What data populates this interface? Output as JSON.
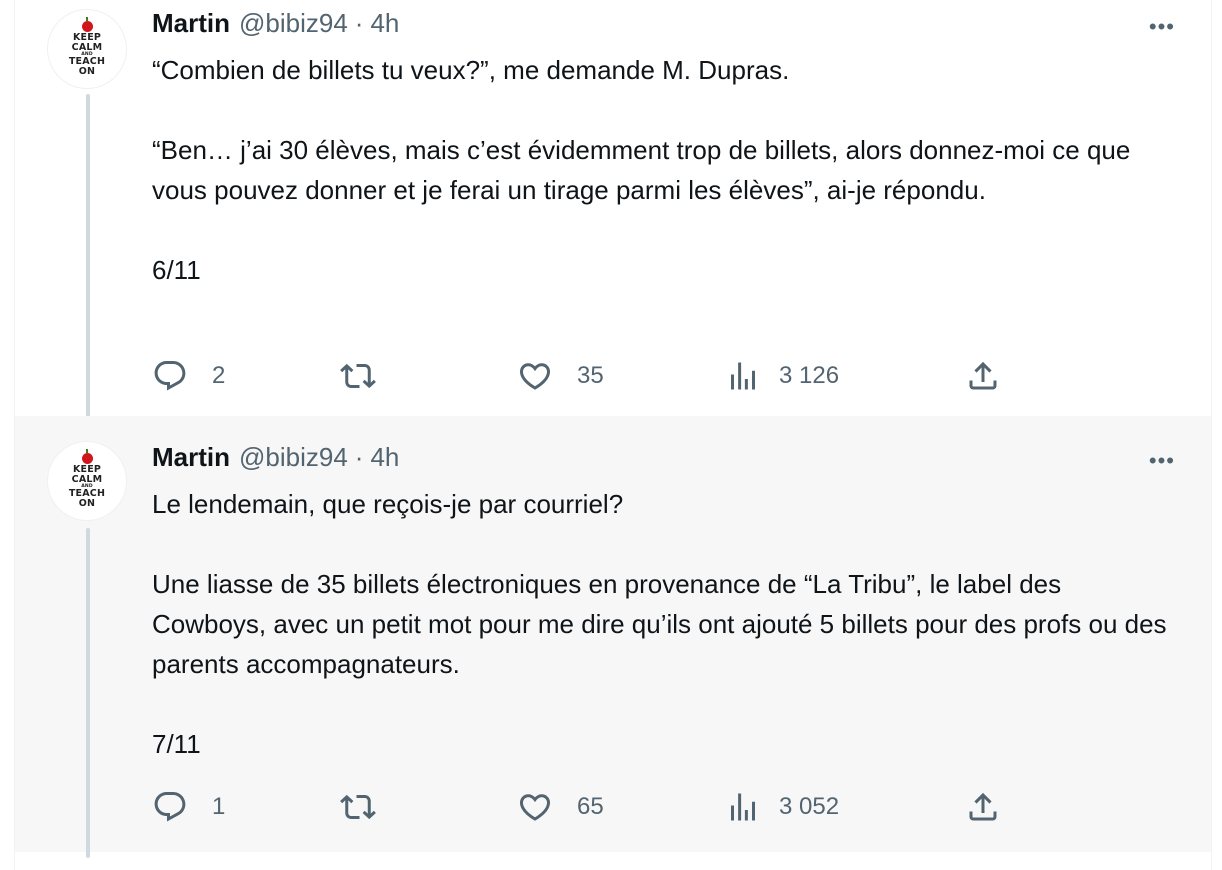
{
  "tweets": [
    {
      "author": {
        "name": "Martin",
        "handle": "@bibiz94",
        "separator": "·",
        "time": "4h"
      },
      "avatar": {
        "line1": "KEEP",
        "line2": "CALM",
        "line3": "AND",
        "line4": "TEACH",
        "line5": "ON"
      },
      "paragraphs": [
        "“Combien de billets tu veux?”, me demande M. Dupras.",
        "“Ben… j’ai 30 élèves, mais c’est évidemment trop de billets, alors donnez-moi ce que vous pouvez donner et je ferai un tirage parmi les élèves”, ai-je répondu.",
        "6/11"
      ],
      "stats": {
        "replies": "2",
        "retweets": "",
        "likes": "35",
        "views": "3 126"
      },
      "more_label": "•••"
    },
    {
      "author": {
        "name": "Martin",
        "handle": "@bibiz94",
        "separator": "·",
        "time": "4h"
      },
      "avatar": {
        "line1": "KEEP",
        "line2": "CALM",
        "line3": "AND",
        "line4": "TEACH",
        "line5": "ON"
      },
      "paragraphs": [
        "Le lendemain, que reçois-je par courriel?",
        "Une liasse de 35 billets électroniques en provenance de “La Tribu”, le label des Cowboys, avec un petit mot pour me dire qu’ils ont ajouté 5 billets pour des profs ou des parents accompagnateurs.",
        "7/11"
      ],
      "stats": {
        "replies": "1",
        "retweets": "",
        "likes": "65",
        "views": "3 052"
      },
      "more_label": "•••"
    }
  ],
  "icons": [
    "reply-icon",
    "retweet-icon",
    "like-icon",
    "views-icon",
    "share-icon",
    "more-icon"
  ],
  "colors": {
    "text": "#0f1419",
    "secondary": "#536471",
    "thread": "#cfd9de",
    "hover_bg": "#f7f7f7"
  }
}
